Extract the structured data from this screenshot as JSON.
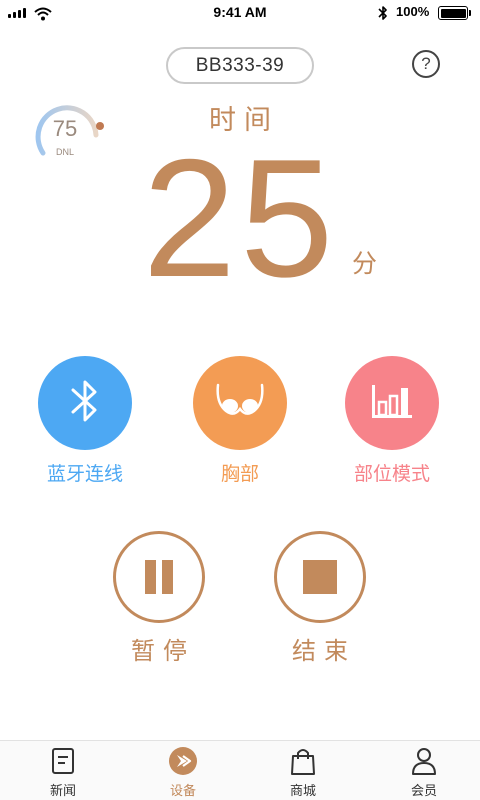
{
  "status_bar": {
    "time": "9:41 AM",
    "battery": "100%",
    "icons": [
      "signal-icon",
      "wifi-icon",
      "bluetooth-icon",
      "battery-icon"
    ]
  },
  "header": {
    "device_id": "BB333-39",
    "help": "?"
  },
  "gauge": {
    "value": "75",
    "unit": "DNL"
  },
  "timer": {
    "label": "时间",
    "value": "25",
    "unit": "分"
  },
  "modes": [
    {
      "label": "蓝牙连线",
      "icon": "bluetooth-icon",
      "color": "#4da8f3"
    },
    {
      "label": "胸部",
      "icon": "chest-icon",
      "color": "#f39c54"
    },
    {
      "label": "部位模式",
      "icon": "bar-chart-icon",
      "color": "#f7838a"
    }
  ],
  "controls": {
    "pause": "暂停",
    "stop": "结束",
    "color": "#c28a5c"
  },
  "tab_bar": {
    "active": "设备",
    "items": [
      {
        "label": "新闻",
        "icon": "news-icon"
      },
      {
        "label": "设备",
        "icon": "device-icon"
      },
      {
        "label": "商城",
        "icon": "shopping-bag-icon"
      },
      {
        "label": "会员",
        "icon": "user-icon"
      }
    ]
  }
}
